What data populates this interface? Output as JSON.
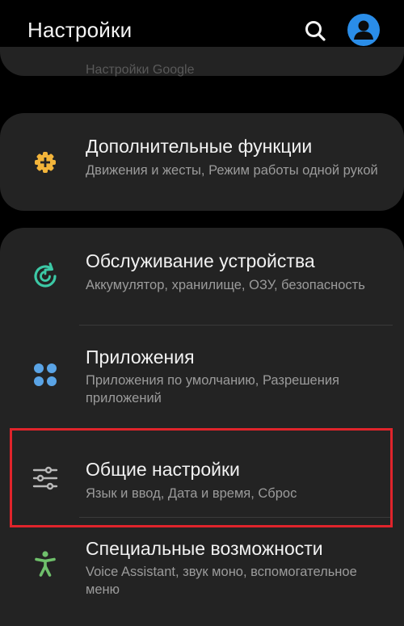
{
  "header": {
    "title": "Настройки"
  },
  "partial_item": {
    "subtitle": "Настройки Google"
  },
  "items": [
    {
      "title": "Дополнительные функции",
      "subtitle": "Движения и жесты, Режим работы одной рукой",
      "icon": "plus-gear-icon",
      "icon_color": "#f2b43a"
    },
    {
      "title": "Обслуживание устройства",
      "subtitle": "Аккумулятор, хранилище, ОЗУ, безопасность",
      "icon": "device-care-icon",
      "icon_color": "#3cc9a6"
    },
    {
      "title": "Приложения",
      "subtitle": "Приложения по умолчанию, Разрешения приложений",
      "icon": "apps-icon",
      "icon_color": "#5aa4e6"
    },
    {
      "title": "Общие настройки",
      "subtitle": "Язык и ввод, Дата и время, Сброс",
      "icon": "sliders-icon",
      "icon_color": "#b9b9b9"
    },
    {
      "title": "Специальные возможности",
      "subtitle": "Voice Assistant, звук моно, вспомогательное меню",
      "icon": "accessibility-icon",
      "icon_color": "#6fc06b"
    }
  ],
  "colors": {
    "background": "#000000",
    "card": "#232323",
    "avatar": "#2a8de8",
    "highlight": "#e0242b"
  }
}
